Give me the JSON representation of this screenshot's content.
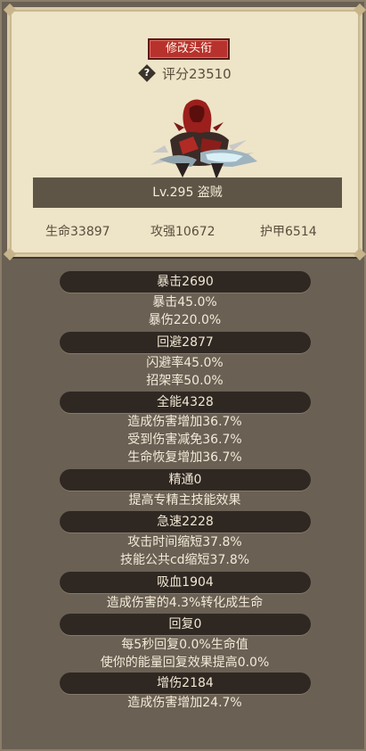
{
  "header": {
    "title_button": "修改头衔",
    "score_label": "评分23510",
    "help_icon_glyph": "?",
    "level_class": "Lv.295 盗贼",
    "stats": {
      "hp": "生命33897",
      "attack": "攻强10672",
      "armor": "护甲6514"
    }
  },
  "attributes": [
    {
      "title": "暴击2690",
      "lines": [
        "暴击45.0%",
        "暴伤220.0%"
      ]
    },
    {
      "title": "回避2877",
      "lines": [
        "闪避率45.0%",
        "招架率50.0%"
      ]
    },
    {
      "title": "全能4328",
      "lines": [
        "造成伤害增加36.7%",
        "受到伤害减免36.7%",
        "生命恢复增加36.7%"
      ]
    },
    {
      "title": "精通0",
      "lines": [
        "提高专精主技能效果"
      ]
    },
    {
      "title": "急速2228",
      "lines": [
        "攻击时间缩短37.8%",
        "技能公共cd缩短37.8%"
      ]
    },
    {
      "title": "吸血1904",
      "lines": [
        "造成伤害的4.3%转化成生命"
      ]
    },
    {
      "title": "回复0",
      "lines": [
        "每5秒回复0.0%生命值",
        "使你的能量回复效果提高0.0%"
      ]
    },
    {
      "title": "增伤2184",
      "lines": [
        "造成伤害增加24.7%"
      ]
    }
  ],
  "colors": {
    "panel_bg": "#6b6155",
    "card_bg": "#eee4c8",
    "title_button": "#b8322d",
    "pill_bg": "#2f2822",
    "text_light": "#f2ead8",
    "text_dark": "#5a4e3d"
  },
  "icons": {
    "help": "question-diamond-icon",
    "avatar": "armored-rogue-character"
  }
}
